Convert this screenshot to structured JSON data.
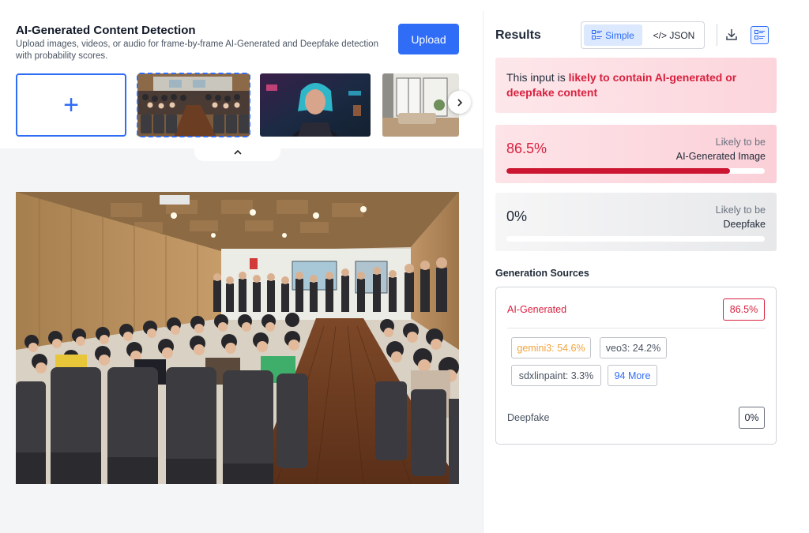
{
  "header": {
    "title": "AI-Generated Content Detection",
    "subtitle": "Upload images, videos, or audio for frame-by-frame AI-Generated and Deepfake detection with probability scores.",
    "upload_label": "Upload"
  },
  "gallery": {
    "add_symbol": "+",
    "next_symbol": "›",
    "collapse_symbol": "⌃"
  },
  "results": {
    "title": "Results",
    "toggle": {
      "simple_label": "Simple",
      "json_label": "</> JSON",
      "active": "Simple"
    },
    "verdict": {
      "prefix": "This input is ",
      "highlight": "likely to contain AI-generated or deepfake content"
    },
    "scores": [
      {
        "value": "86.5%",
        "label_top": "Likely to be",
        "label_bottom": "AI-Generated Image",
        "fill_percent": 86.5
      },
      {
        "value": "0%",
        "label_top": "Likely to be",
        "label_bottom": "Deepfake",
        "fill_percent": 0
      }
    ]
  },
  "generation_sources": {
    "title": "Generation Sources",
    "ai_label": "AI-Generated",
    "ai_value": "86.5%",
    "chips": [
      {
        "label": "gemini3: 54.6%"
      },
      {
        "label": "veo3: 24.2%"
      },
      {
        "label": "sdxlinpaint: 3.3%"
      },
      {
        "label": "94 More"
      }
    ],
    "deepfake_label": "Deepfake",
    "deepfake_value": "0%"
  },
  "colors": {
    "accent": "#2f6df6",
    "danger": "#d9213f",
    "warning": "#f0a43c"
  }
}
